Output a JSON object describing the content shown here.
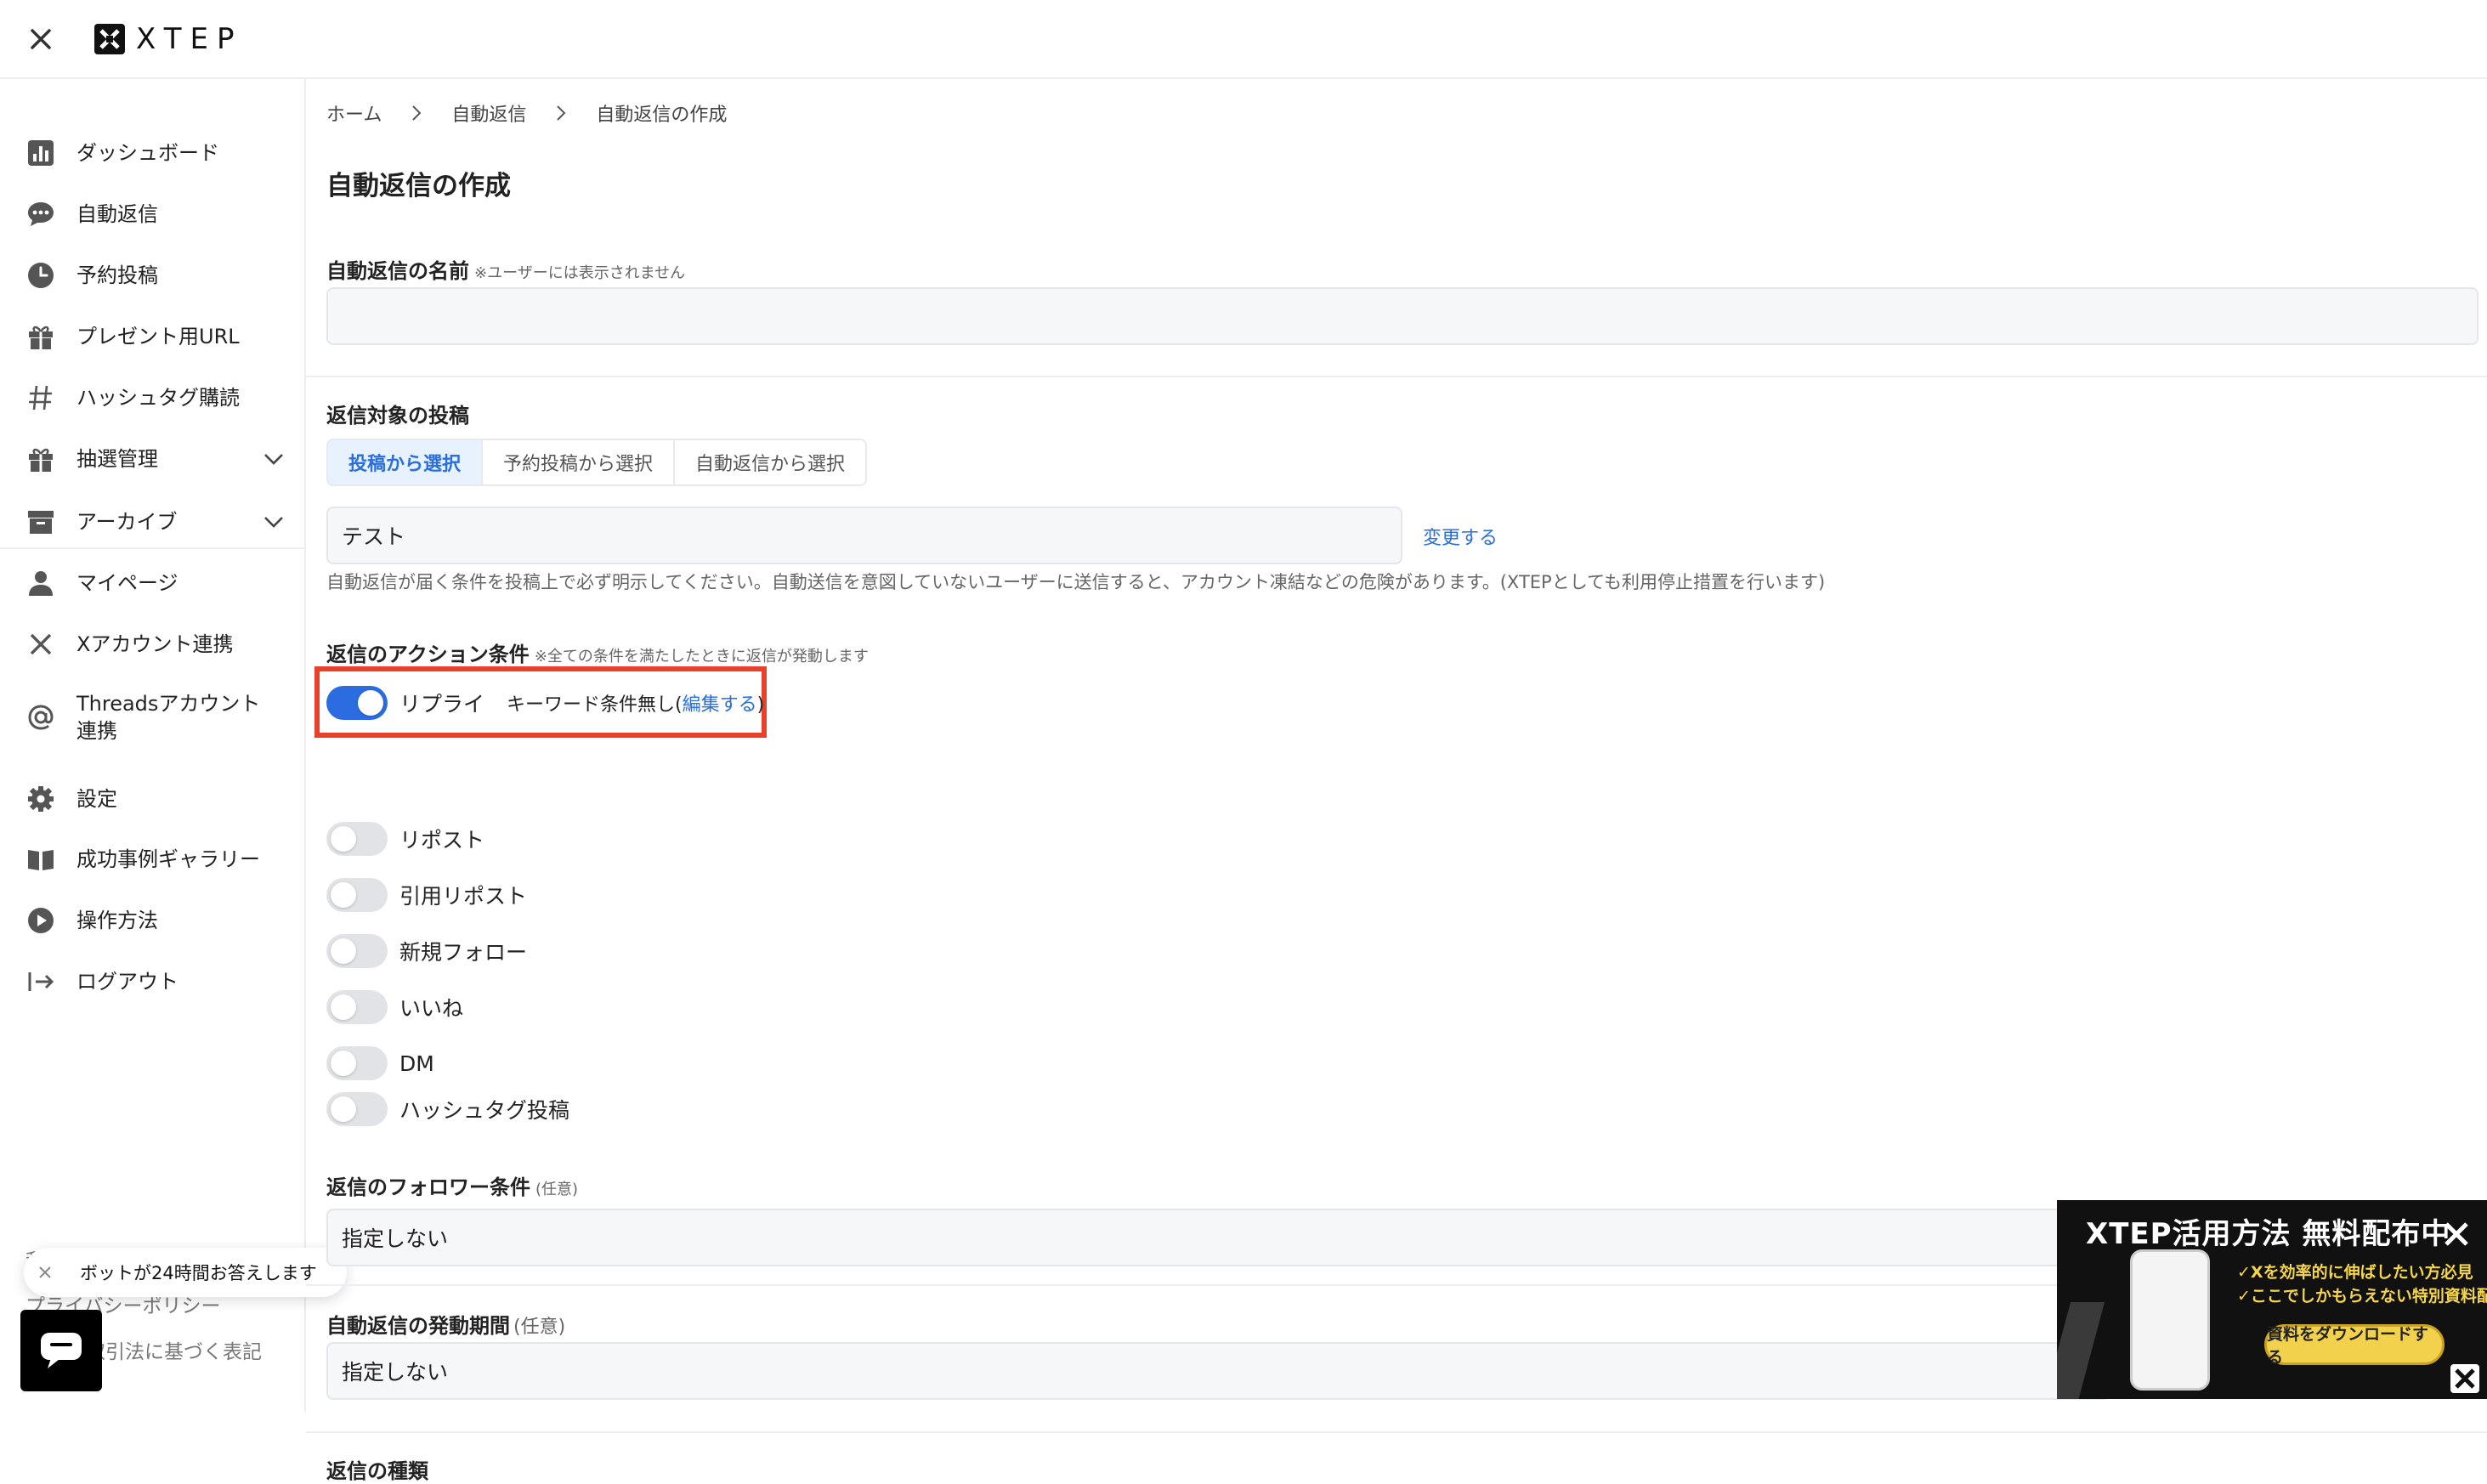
{
  "app": {
    "name": "XTEP"
  },
  "sidebar": {
    "items": [
      {
        "label": "ダッシュボード",
        "icon": "bar-chart-icon"
      },
      {
        "label": "自動返信",
        "icon": "chat-bubble-icon"
      },
      {
        "label": "予約投稿",
        "icon": "clock-icon"
      },
      {
        "label": "プレゼント用URL",
        "icon": "gift-icon"
      },
      {
        "label": "ハッシュタグ購読",
        "icon": "hashtag-icon"
      },
      {
        "label": "抽選管理",
        "icon": "gift-icon"
      },
      {
        "label": "アーカイブ",
        "icon": "archive-icon"
      },
      {
        "label": "マイページ",
        "icon": "user-icon"
      },
      {
        "label": "Xアカウント連携",
        "icon": "x-logo-icon"
      },
      {
        "label": "Threadsアカウント連携",
        "icon": "at-icon"
      },
      {
        "label": "設定",
        "icon": "gear-icon"
      },
      {
        "label": "成功事例ギャラリー",
        "icon": "book-icon"
      },
      {
        "label": "操作方法",
        "icon": "play-icon"
      },
      {
        "label": "ログアウト",
        "icon": "logout-icon"
      }
    ],
    "footer": {
      "terms": "利用規",
      "privacy": "プライバシーポリシー",
      "commerce": "特定商取引法に基づく表記"
    }
  },
  "breadcrumb": [
    "ホーム",
    "自動返信",
    "自動返信の作成"
  ],
  "page": {
    "title": "自動返信の作成"
  },
  "form": {
    "name_label": "自動返信の名前",
    "name_note": "※ユーザーには表示されません",
    "name_value": "",
    "target_label": "返信対象の投稿",
    "tabs": [
      "投稿から選択",
      "予約投稿から選択",
      "自動返信から選択"
    ],
    "target_value": "テスト",
    "change_link": "変更する",
    "warning": "自動返信が届く条件を投稿上で必ず明示してください。自動送信を意図していないユーザーに送信すると、アカウント凍結などの危険があります。(XTEPとしても利用停止措置を行います)",
    "action_label": "返信のアクション条件",
    "action_note": "※全ての条件を満たしたときに返信が発動します",
    "actions": [
      {
        "label": "リプライ",
        "on": true
      },
      {
        "label": "リポスト",
        "on": false
      },
      {
        "label": "引用リポスト",
        "on": false
      },
      {
        "label": "新規フォロー",
        "on": false
      },
      {
        "label": "いいね",
        "on": false
      },
      {
        "label": "DM",
        "on": false
      },
      {
        "label": "ハッシュタグ投稿",
        "on": false
      }
    ],
    "keyword_prefix": "キーワード条件無し(",
    "keyword_link": "編集する",
    "keyword_suffix": ")",
    "follower_label": "返信のフォロワー条件",
    "follower_note": "(任意)",
    "follower_value": "指定しない",
    "period_label": "自動返信の発動期間",
    "period_note": "(任意)",
    "period_value": "指定しない",
    "type_label": "返信の種類"
  },
  "chat": {
    "tooltip": "ボットが24時間お答えします"
  },
  "banner": {
    "title": "XTEP活用方法 無料配布中",
    "bullet1": "✓Xを効率的に伸ばしたい方必見",
    "bullet2": "✓ここでしかもらえない特別資料配布",
    "button": "資料をダウンロードする"
  },
  "colors": {
    "accent": "#2b6de0",
    "highlight": "#e8412b",
    "banner_yellow": "#f2d24c"
  }
}
